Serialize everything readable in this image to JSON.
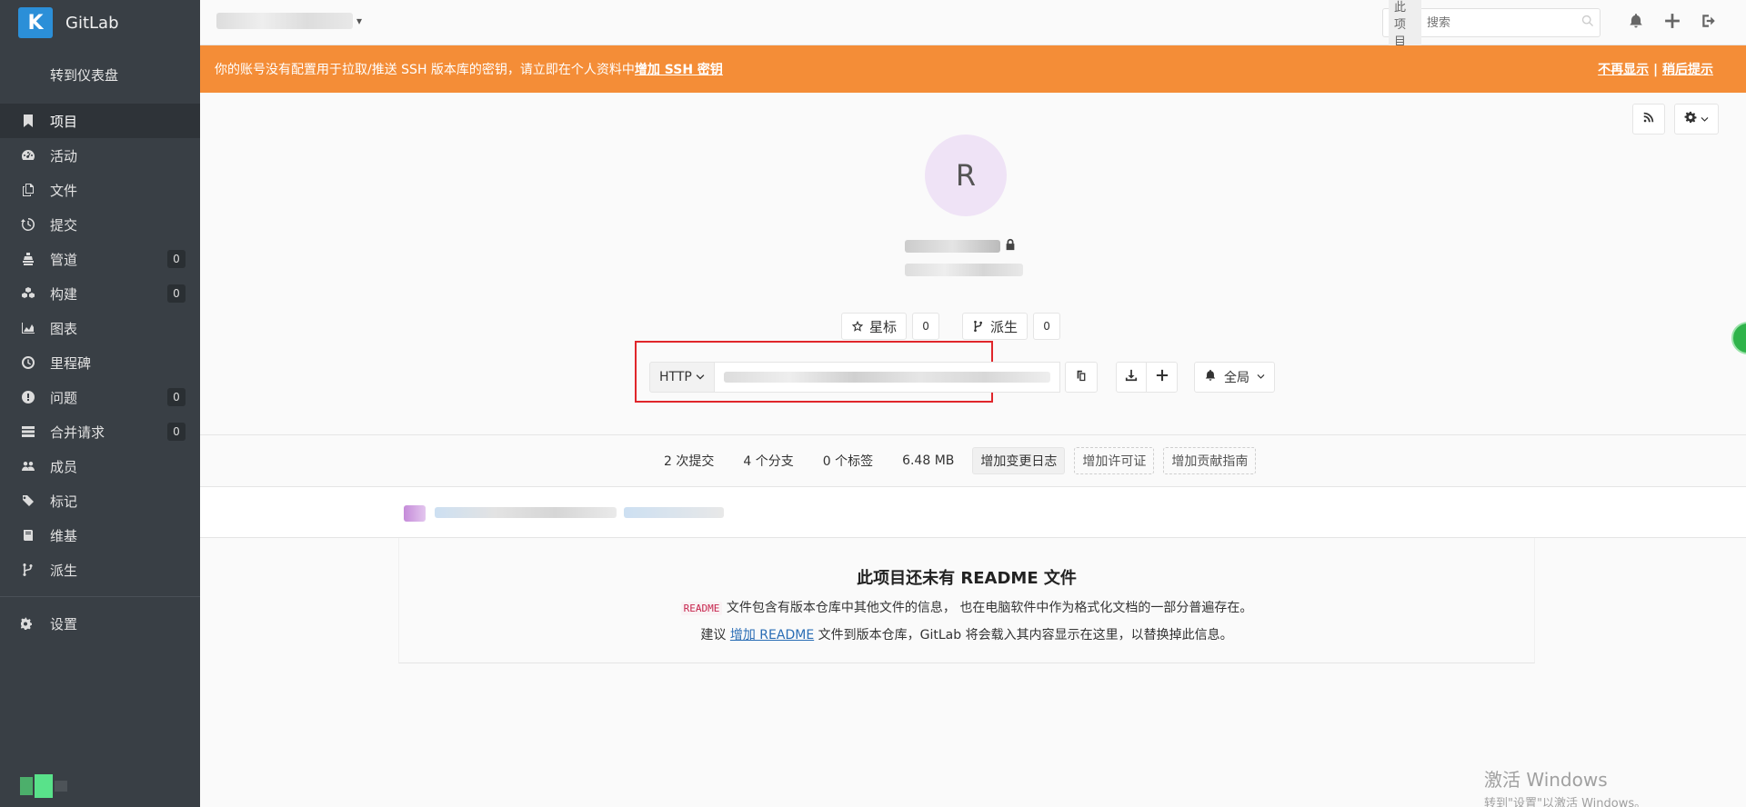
{
  "sidebar": {
    "brand": "GitLab",
    "brand_initial": "K",
    "dashboard_link": "转到仪表盘",
    "items": [
      {
        "label": "项目",
        "icon": "bookmark-icon",
        "count": null,
        "active": true
      },
      {
        "label": "活动",
        "icon": "dashboard-icon",
        "count": null
      },
      {
        "label": "文件",
        "icon": "files-icon",
        "count": null
      },
      {
        "label": "提交",
        "icon": "history-icon",
        "count": null
      },
      {
        "label": "管道",
        "icon": "pipeline-icon",
        "count": "0"
      },
      {
        "label": "构建",
        "icon": "cubes-icon",
        "count": "0"
      },
      {
        "label": "图表",
        "icon": "area-chart-icon",
        "count": null
      },
      {
        "label": "里程碑",
        "icon": "clock-icon",
        "count": null
      },
      {
        "label": "问题",
        "icon": "exclamation-circle-icon",
        "count": "0"
      },
      {
        "label": "合并请求",
        "icon": "tasks-icon",
        "count": "0"
      },
      {
        "label": "成员",
        "icon": "users-icon",
        "count": null
      },
      {
        "label": "标记",
        "icon": "tags-icon",
        "count": null
      },
      {
        "label": "维基",
        "icon": "book-icon",
        "count": null
      },
      {
        "label": "派生",
        "icon": "fork-icon",
        "count": null
      }
    ],
    "settings_label": "设置"
  },
  "header": {
    "search_scope": "此项目",
    "search_placeholder": "搜索"
  },
  "banner": {
    "text": "你的账号没有配置用于拉取/推送 SSH 版本库的密钥，请立即在个人资料中",
    "link": "增加 SSH 密钥",
    "dismiss": "不再显示",
    "separator": "|",
    "later": "稍后提示"
  },
  "project": {
    "avatar_letter": "R",
    "star_label": "星标",
    "star_count": "0",
    "fork_label": "派生",
    "fork_count": "0",
    "clone_protocol": "HTTP",
    "notification_label": "全局"
  },
  "stats": {
    "commits": "2 次提交",
    "branches": "4 个分支",
    "tags": "0 个标签",
    "size": "6.48 MB",
    "add_changelog": "增加变更日志",
    "add_license": "增加许可证",
    "add_contributing": "增加贡献指南"
  },
  "readme": {
    "title": "此项目还未有 README 文件",
    "line1_code": "README",
    "line1_text": " 文件包含有版本仓库中其他文件的信息， 也在电脑软件中作为格式化文档的一部分普遍存在。",
    "line2_prefix": "建议 ",
    "line2_link": "增加 README",
    "line2_suffix": " 文件到版本仓库，GitLab 将会载入其内容显示在这里，以替换掉此信息。"
  },
  "watermark": {
    "title": "激活 Windows",
    "subtitle": "转到\"设置\"以激活 Windows。"
  },
  "colors": {
    "sidebar_bg": "#393f45",
    "banner_bg": "#f48d37",
    "highlight_border": "#e0262b",
    "link": "#2a6db5"
  }
}
